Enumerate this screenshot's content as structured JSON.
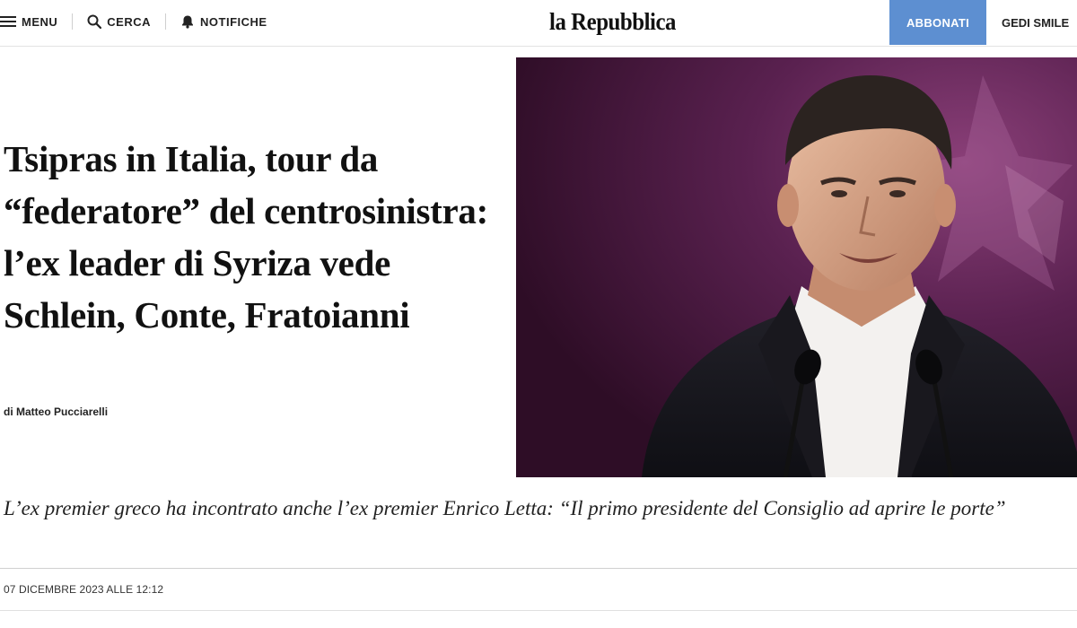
{
  "header": {
    "menu_label": "MENU",
    "search_label": "CERCA",
    "notifications_label": "NOTIFICHE",
    "logo_text": "la Repubblica",
    "subscribe_label": "ABBONATI",
    "gedi_label": "GEDI SMILE"
  },
  "article": {
    "headline": "Tsipras in Italia, tour da “federatore” del centrosinistra: l’ex leader di Syriza vede Schlein, Conte, Fratoianni",
    "byline_prefix": "di",
    "author": "Matteo Pucciarelli",
    "subtitle": "L’ex premier greco ha incontrato anche l’ex premier Enrico Letta: “Il primo presidente del Consiglio ad aprire le porte”",
    "timestamp": "07 DICEMBRE 2023 ALLE 12:12"
  },
  "icons": {
    "menu": "hamburger-icon",
    "search": "search-icon",
    "notifications": "bell-icon"
  },
  "colors": {
    "accent": "#5d8fd1",
    "photo_background": "#4a1d3c"
  }
}
